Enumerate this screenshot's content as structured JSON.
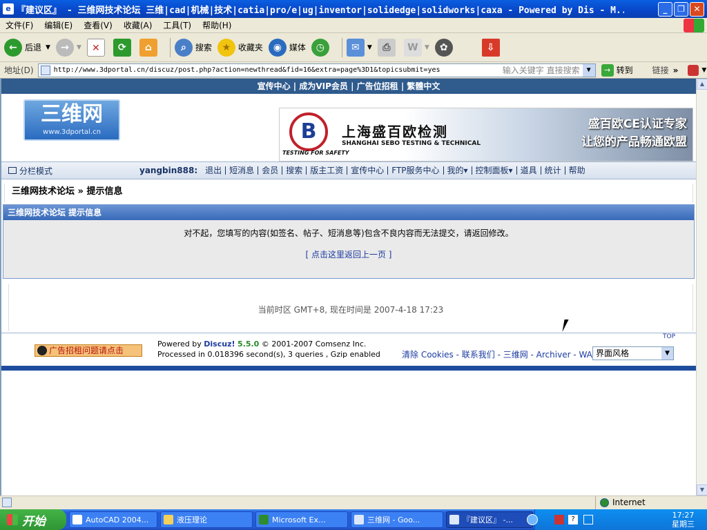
{
  "window": {
    "title": "『建议区』 - 三维网技术论坛 三维|cad|机械|技术|catia|pro/e|ug|inventor|solidedge|solidworks|caxa - Powered by Dis - M...",
    "icon": "ie-icon"
  },
  "menu": [
    "文件(F)",
    "编辑(E)",
    "查看(V)",
    "收藏(A)",
    "工具(T)",
    "帮助(H)"
  ],
  "toolbar": {
    "back": "后退",
    "search": "搜索",
    "favorites": "收藏夹",
    "media": "媒体"
  },
  "address": {
    "label": "地址(D)",
    "url": "http://www.3dportal.cn/discuz/post.php?action=newthread&fid=16&extra=page%3D1&topicsubmit=yes",
    "search_hint": "输入关键字 直接搜索",
    "go": "转到",
    "links": "链接"
  },
  "site": {
    "topnav": [
      "宣传中心",
      "成为VIP会员",
      "广告位招租",
      "繁體中文"
    ],
    "logo_text": "三维网",
    "logo_url": "www.3dportal.cn",
    "banner": {
      "logo_letter": "B",
      "tagline": "TESTING FOR SAFETY",
      "title": "上海盛百欧检测",
      "subtitle": "SHANGHAI SEBO TESTING & TECHNICAL",
      "slogan1": "盛百欧CE认证专家",
      "slogan2": "让您的产品畅通欧盟"
    },
    "nav": {
      "mode": "分栏模式",
      "user": "yangbin888:",
      "links": [
        "退出",
        "短消息",
        "会员",
        "搜索",
        "版主工资",
        "宣传中心",
        "FTP服务中心",
        "我的▾",
        "控制面板▾",
        "道具",
        "统计",
        "帮助"
      ]
    },
    "breadcrumb": "三维网技术论坛 » 提示信息",
    "message": {
      "header": "三维网技术论坛 提示信息",
      "text": "对不起，您填写的内容(如签名、帖子、短消息等)包含不良内容而无法提交，请返回修改。",
      "back_link": "[ 点击这里返回上一页 ]"
    },
    "timezone": "当前时区 GMT+8, 现在时间是 2007-4-18 17:23",
    "footer": {
      "ad_button": "广告招租问题请点击",
      "powered_prefix": "Powered by ",
      "discuz": "Discuz!",
      "version": "5.5.0",
      "copyright": "© 2001-2007 Comsenz Inc.",
      "processed": "Processed in 0.018396 second(s), 3 queries , Gzip enabled",
      "top": "TOP",
      "links": "清除 Cookies - 联系我们 - 三维网 - Archiver - WAP",
      "style_select": "界面风格"
    }
  },
  "status": {
    "zone": "Internet"
  },
  "taskbar": {
    "start": "开始",
    "tasks": [
      "AutoCAD 2004...",
      "液压理论",
      "Microsoft Ex...",
      "三维网 - Goo...",
      "『建议区』 -..."
    ],
    "time": "17:27",
    "day": "星期三"
  }
}
